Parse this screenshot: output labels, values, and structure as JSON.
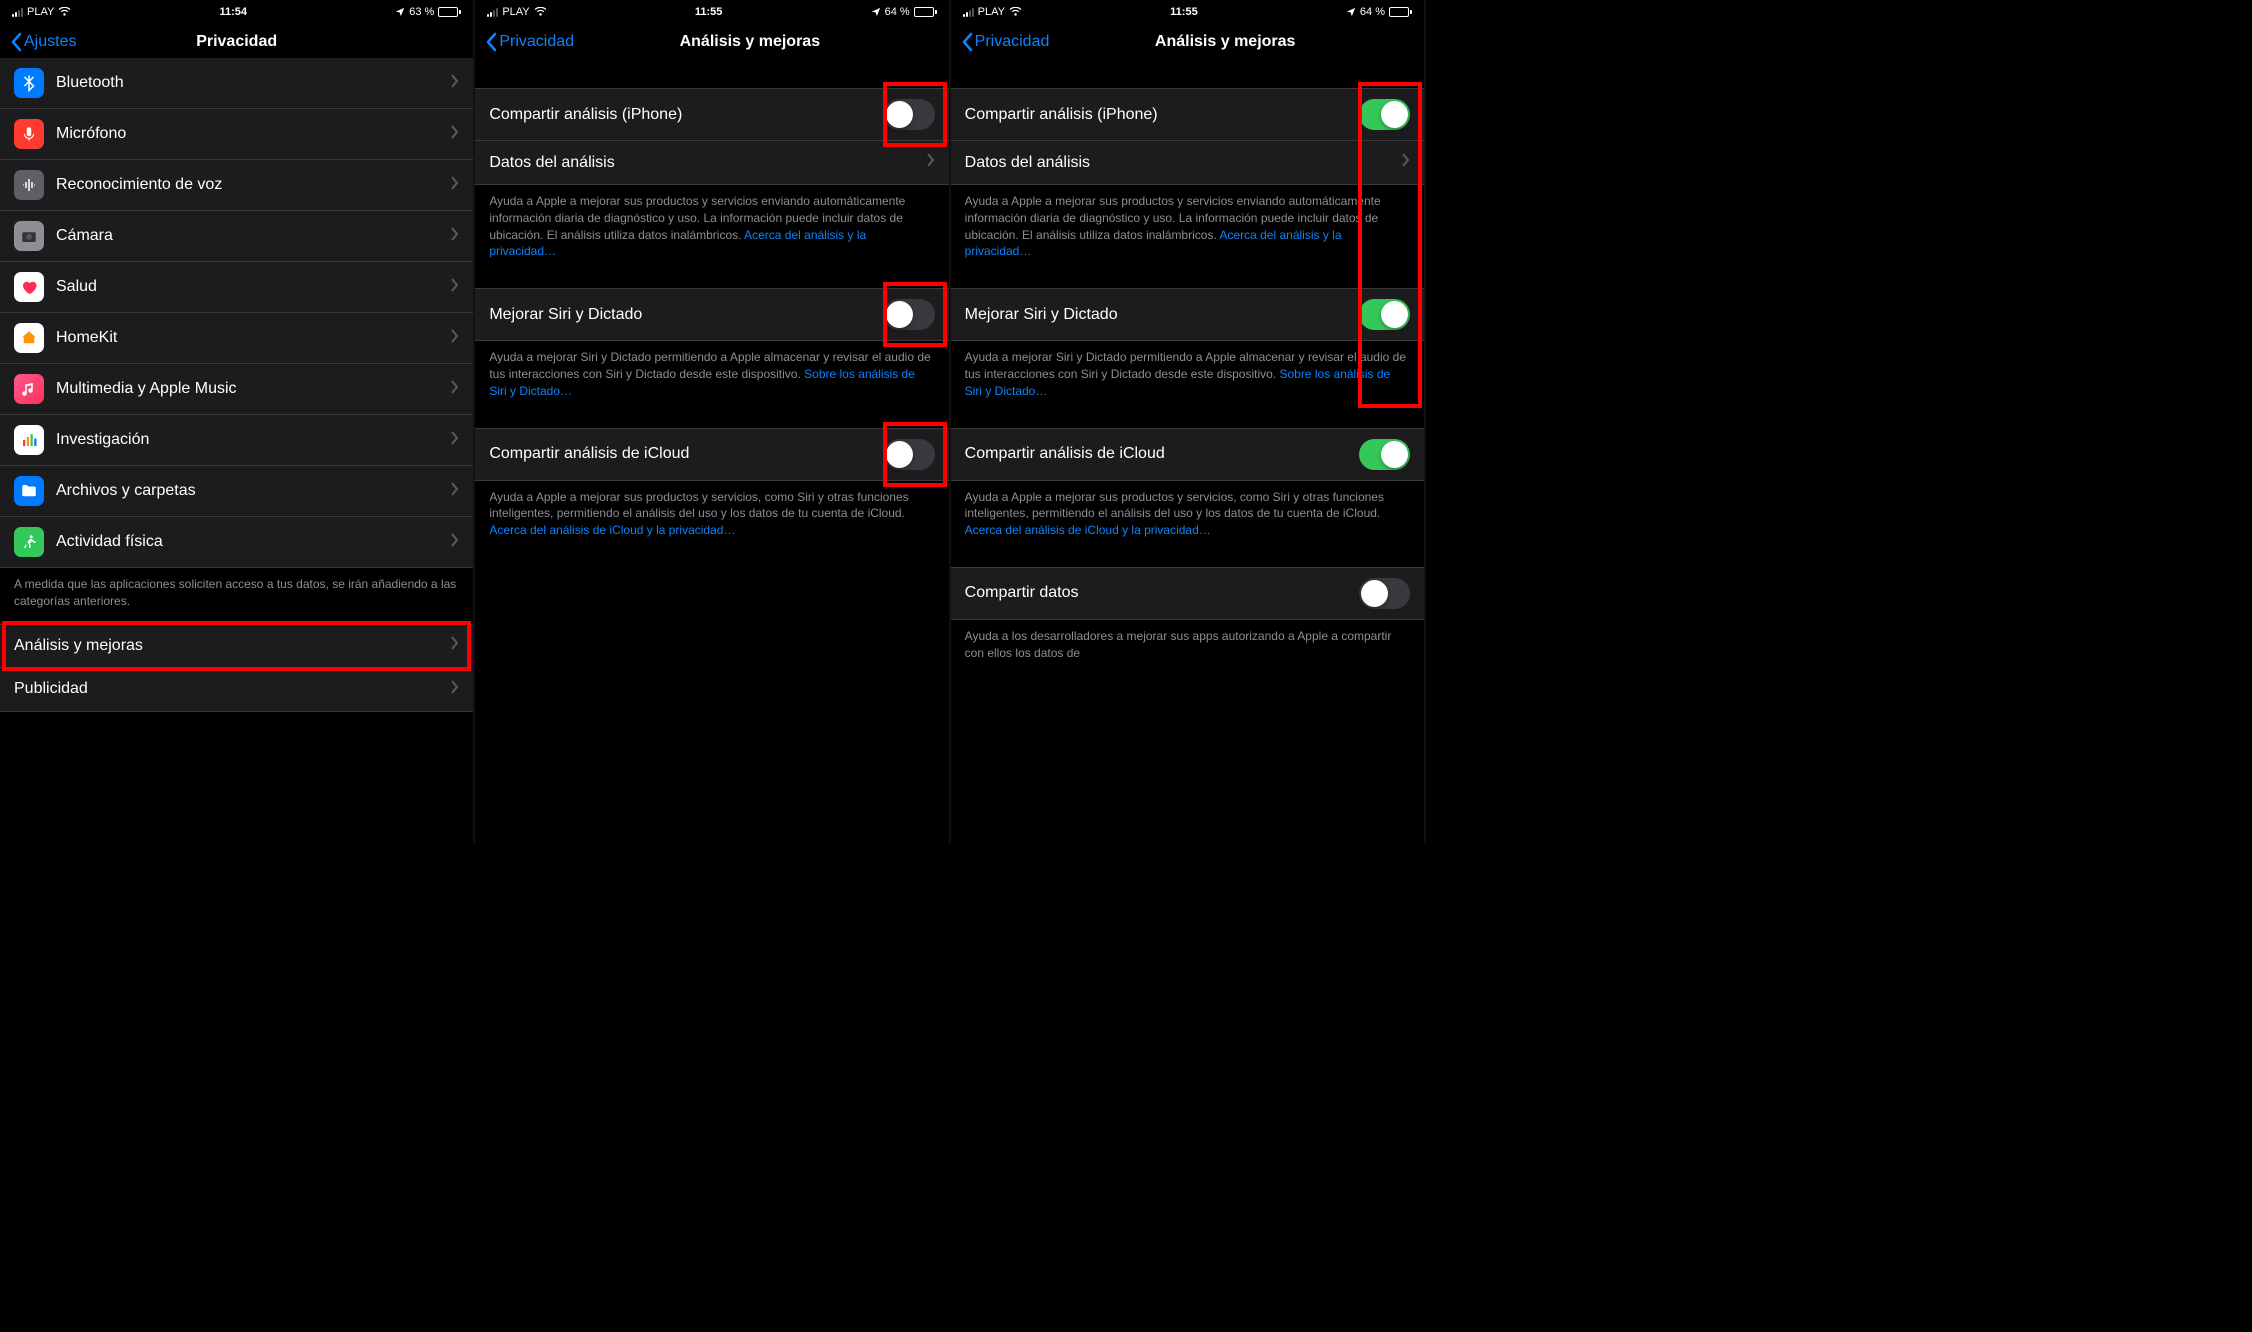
{
  "status": {
    "carrier": "PLAY",
    "time1": "11:54",
    "time2": "11:55",
    "time3": "11:55",
    "battery1": "63 %",
    "battery2": "64 %",
    "battery3": "64 %",
    "batteryFill1": 63,
    "batteryFill2": 64,
    "batteryFill3": 64
  },
  "screen1": {
    "back": "Ajustes",
    "title": "Privacidad",
    "items": [
      {
        "label": "Bluetooth",
        "iconBg": "#007aff",
        "iconKey": "bluetooth"
      },
      {
        "label": "Micrófono",
        "iconBg": "#ff3b30",
        "iconKey": "mic"
      },
      {
        "label": "Reconocimiento de voz",
        "iconBg": "#5e5e63",
        "iconKey": "wave"
      },
      {
        "label": "Cámara",
        "iconBg": "#8e8e93",
        "iconKey": "camera"
      },
      {
        "label": "Salud",
        "iconBg": "#ffffff",
        "iconKey": "heart"
      },
      {
        "label": "HomeKit",
        "iconBg": "#ffffff",
        "iconKey": "home"
      },
      {
        "label": "Multimedia y Apple Music",
        "iconBg": "#ffffff",
        "iconKey": "music"
      },
      {
        "label": "Investigación",
        "iconBg": "#ffffff",
        "iconKey": "bars"
      },
      {
        "label": "Archivos y carpetas",
        "iconBg": "#007aff",
        "iconKey": "folder"
      },
      {
        "label": "Actividad física",
        "iconBg": "#34c759",
        "iconKey": "run"
      }
    ],
    "footer": "A medida que las aplicaciones soliciten acceso a tus datos, se irán añadiendo a las categorías anteriores.",
    "analysisRow": "Análisis y mejoras",
    "adsRow": "Publicidad"
  },
  "screen2": {
    "back": "Privacidad",
    "title": "Análisis y mejoras",
    "row1": "Compartir análisis (iPhone)",
    "row2": "Datos del análisis",
    "footer1a": "Ayuda a Apple a mejorar sus productos y servicios enviando automáticamente información diaria de diagnóstico y uso. La información puede incluir datos de ubicación. El análisis utiliza datos inalámbricos. ",
    "footer1b": "Acerca del análisis y la privacidad…",
    "row3": "Mejorar Siri y Dictado",
    "footer2a": "Ayuda a mejorar Siri y Dictado permitiendo a Apple almacenar y revisar el audio de tus interacciones con Siri y Dictado desde este dispositivo. ",
    "footer2b": "Sobre los análisis de Siri y Dictado…",
    "row4": "Compartir análisis de iCloud",
    "footer3a": "Ayuda a Apple a mejorar sus productos y servicios, como Siri y otras funciones inteligentes, permitiendo el análisis del uso y los datos de tu cuenta de iCloud. ",
    "footer3b": "Acerca del análisis de iCloud y la privacidad…"
  },
  "screen3": {
    "row5": "Compartir datos",
    "footer4": "Ayuda a los desarrolladores a mejorar sus apps autorizando a Apple a compartir con ellos los datos de"
  }
}
